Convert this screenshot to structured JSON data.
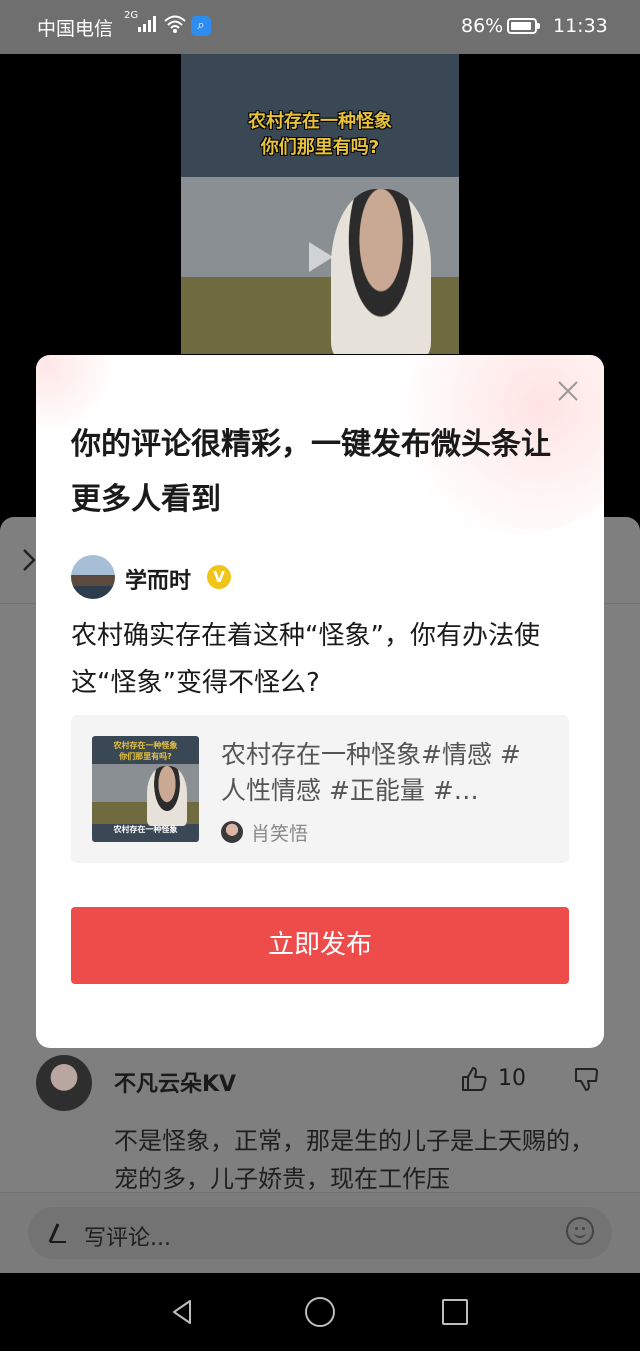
{
  "status_bar": {
    "carrier": "中国电信",
    "network": "2G",
    "battery_percent": "86%",
    "time": "11:33"
  },
  "video": {
    "cover_title_line1": "农村存在一种怪象",
    "cover_title_line2": "你们那里有吗?"
  },
  "modal": {
    "headline": "你的评论很精彩，一键发布微头条让更多人看到",
    "author_name": "学而时",
    "verified_badge": "V",
    "comment_body": "农村确实存在着这种“怪象”，你有办法使这“怪象”变得不怪么?",
    "card": {
      "title": "农村存在一种怪象#情感 #人性情感 #正能量 #…",
      "author": "肖笑悟",
      "thumb_title_line1": "农村存在一种怪象",
      "thumb_title_line2": "你们那里有吗?",
      "thumb_caption": "农村存在一种怪象"
    },
    "publish_label": "立即发布"
  },
  "comment": {
    "user": "不凡云朵KV",
    "like_count": "10",
    "text": "不是怪象，正常，那是生的儿子是上天赐的，宠的多，儿子娇贵，现在工作压"
  },
  "input_bar": {
    "placeholder": "写评论..."
  },
  "colors": {
    "primary_button": "#ee4b4b",
    "verified": "#f0c419"
  }
}
